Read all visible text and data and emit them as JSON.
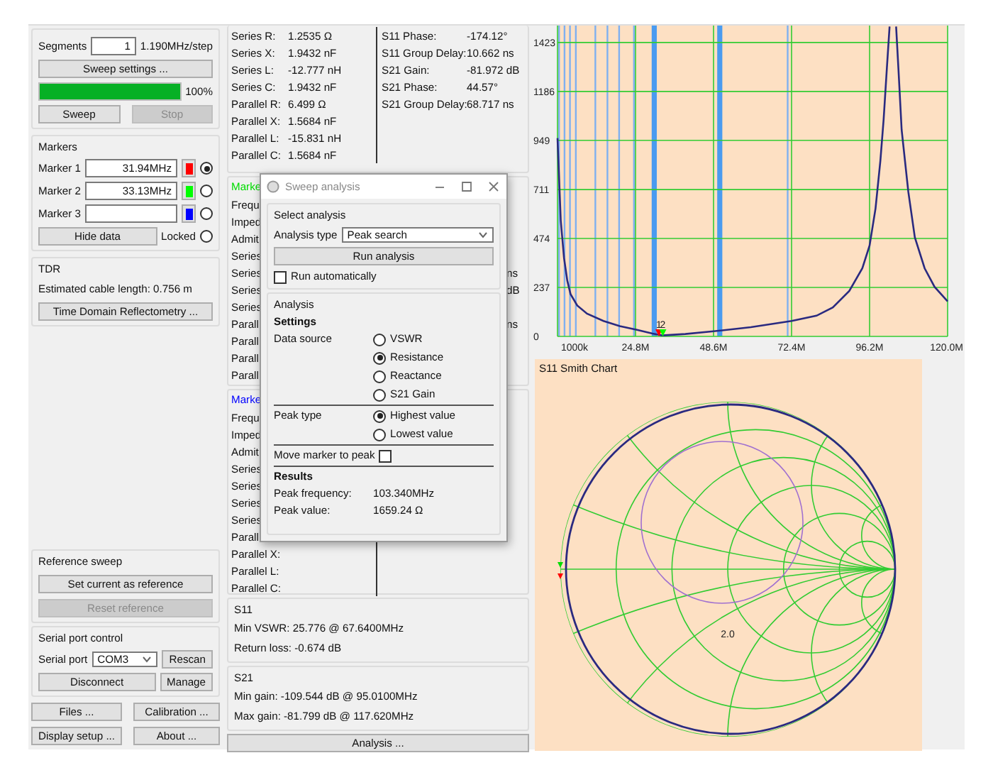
{
  "sweep_panel": {
    "segments_label": "Segments",
    "segments_value": "1",
    "step": "1.190MHz/step",
    "settings_button": "Sweep settings ...",
    "progress": {
      "level": 1,
      "reading": "100%"
    },
    "sweep_button": {
      "label": "Sweep",
      "disabled": false
    },
    "stop_button": {
      "label": "Stop",
      "disabled": true
    }
  },
  "markers_panel": {
    "title": "Markers",
    "markers": [
      {
        "label": "Marker 1",
        "value": "31.94MHz",
        "color": "#ff0000",
        "selected": true
      },
      {
        "label": "Marker 2",
        "value": "33.13MHz",
        "color": "#00ff00",
        "selected": false
      },
      {
        "label": "Marker 3",
        "color": "#0000ff",
        "selected": false
      }
    ],
    "hide_button": "Hide data",
    "locked": {
      "label": "Locked",
      "checked": false
    }
  },
  "tdr_panel": {
    "title": "TDR",
    "cable_length": "Estimated cable length:  0.756 m",
    "button": "Time Domain Reflectometry ..."
  },
  "reference_panel": {
    "title": "Reference sweep",
    "set_button": {
      "label": "Set current as reference",
      "disabled": false
    },
    "reset_button": {
      "label": "Reset reference",
      "disabled": true
    }
  },
  "serial_panel": {
    "title": "Serial port control",
    "port_label": "Serial port",
    "port_value": "COM3",
    "rescan_button": "Rescan",
    "disconnect_button": "Disconnect",
    "manage_button": "Manage"
  },
  "bottom_buttons": [
    "Files ...",
    "Calibration ...",
    "Display setup ...",
    "About ..."
  ],
  "marker_details": [
    {
      "rows": [
        {
          "label": "Series R:",
          "value": "1.2535 Ω",
          "right_label": "S11 Phase:",
          "right_value": "-174.12°"
        },
        {
          "label": "Series X:",
          "value": "1.9432 nF",
          "right_label": "S11 Group Delay:",
          "right_value": "10.662 ns"
        },
        {
          "label": "Series L:",
          "value": "-12.777 nH",
          "right_label": "S21 Gain:",
          "right_value": "-81.972 dB"
        },
        {
          "label": "Series C:",
          "value": "1.9432 nF",
          "right_label": "S21 Phase:",
          "right_value": "44.57°"
        },
        {
          "label": "Parallel R:",
          "value": "6.499 Ω",
          "right_label": "S21 Group Delay:",
          "right_value": "68.717 ns"
        },
        {
          "label": "Parallel X:",
          "value": "1.5684 nF"
        },
        {
          "label": "Parallel L:",
          "value": "-15.831 nH"
        },
        {
          "label": "Parallel C:",
          "value": "1.5684 nF"
        }
      ]
    },
    {
      "title": "Marke",
      "color": "#00dd00",
      "rows": [
        {
          "label": "Frequ"
        },
        {
          "label": "Imped"
        },
        {
          "label": "Admit"
        },
        {
          "label": "Series"
        },
        {
          "label": "Series",
          "right_value": "ns"
        },
        {
          "label": "Series",
          "right_value": "dB"
        },
        {
          "label": "Series"
        },
        {
          "label": "Parall",
          "right_value": "ns"
        },
        {
          "label": "Parall"
        },
        {
          "label": "Parall"
        },
        {
          "label": "Parall"
        }
      ]
    },
    {
      "title": "Marke",
      "color": "#0000ff",
      "rows": [
        {
          "label": "Frequ"
        },
        {
          "label": "Imped"
        },
        {
          "label": "Admit"
        },
        {
          "label": "Series"
        },
        {
          "label": "Series"
        },
        {
          "label": "Series"
        },
        {
          "label": "Series"
        },
        {
          "label": "Parall"
        },
        {
          "label": "Parallel X:"
        },
        {
          "label": "Parallel L:"
        },
        {
          "label": "Parallel C:"
        }
      ]
    }
  ],
  "s11_panel": {
    "title": "S11",
    "lines": [
      "Min VSWR:  25.776 @ 67.6400MHz",
      "Return loss:  -0.674 dB"
    ]
  },
  "s21_panel": {
    "title": "S21",
    "lines": [
      "Min gain:  -109.544 dB @ 95.0100MHz",
      "Max gain:  -81.799 dB @ 117.620MHz"
    ]
  },
  "analysis_button": "Analysis ...",
  "response_chart": {
    "chart_data": {
      "type": "line",
      "x": [
        1000000,
        2000000,
        3000000,
        4000000,
        5000000,
        7000000,
        10000000,
        15000000,
        20000000,
        25000000,
        30000000,
        33000000,
        40000000,
        48600000,
        60000000,
        72400000,
        80000000,
        85000000,
        90000000,
        94000000,
        96200000,
        98000000,
        99500000,
        100500000,
        101500000,
        102300000,
        103340000,
        104300000,
        105000000,
        106000000,
        108000000,
        110000000,
        113000000,
        116000000,
        120000000
      ],
      "series": [
        {
          "color": "#2a2a80",
          "values": [
            960,
            560,
            380,
            270,
            205,
            150,
            110,
            75,
            50,
            32,
            14,
            5,
            12,
            25,
            45,
            75,
            100,
            140,
            220,
            330,
            440,
            620,
            850,
            1050,
            1300,
            1500,
            null,
            1500,
            1300,
            1000,
            700,
            480,
            330,
            240,
            170
          ]
        }
      ],
      "xlim": [
        1000000,
        120000000
      ],
      "ylim": [
        0,
        1505
      ],
      "grid": true,
      "xticks": [
        {
          "value": 1000000,
          "label": "1000k"
        },
        {
          "value": 24800000,
          "label": "24.8M"
        },
        {
          "value": 48600000,
          "label": "48.6M"
        },
        {
          "value": 72400000,
          "label": "72.4M"
        },
        {
          "value": 96200000,
          "label": "96.2M"
        },
        {
          "value": 120000000,
          "label": "120.0M"
        }
      ],
      "yticks": [
        0,
        237,
        474,
        711,
        949,
        1186,
        1423
      ],
      "ref_lines": [
        {
          "axis": "x",
          "value": 1476000,
          "color": "#7fb0f0"
        },
        {
          "axis": "x",
          "value": 3142000,
          "color": "#7fb0f0"
        },
        {
          "axis": "x",
          "value": 4808000,
          "color": "#7fb0f0"
        },
        {
          "axis": "x",
          "value": 6593000,
          "color": "#7fb0f0"
        },
        {
          "axis": "x",
          "value": 12543000,
          "color": "#7fb0f0"
        },
        {
          "axis": "x",
          "value": 16232000,
          "color": "#7fb0f0"
        },
        {
          "axis": "x",
          "value": 19802000,
          "color": "#7fb0f0"
        },
        {
          "axis": "x",
          "value": 24324000,
          "color": "#7fb0f0"
        },
        {
          "axis": "x",
          "value": 30510000,
          "color": "#4a9bf0"
        },
        {
          "axis": "x",
          "value": 50500000,
          "color": "#4a9bf0"
        },
        {
          "axis": "x",
          "value": 71210000,
          "color": "#7fb0f0"
        }
      ],
      "annotations": [
        {
          "x": 31940000,
          "y": 0,
          "text": "1"
        },
        {
          "x": 33130000,
          "y": 0,
          "text": "2"
        }
      ]
    }
  },
  "smith_chart": {
    "title": "S11 Smith Chart",
    "circle_label": "2.0"
  },
  "dialog": {
    "title": "Sweep analysis",
    "select_group": {
      "title": "Select analysis",
      "type_label": "Analysis type",
      "type_value": "Peak search",
      "run_button": "Run analysis",
      "run_automatically": {
        "label": "Run automatically",
        "checked": false
      }
    },
    "analysis_group": {
      "title": "Analysis",
      "settings_heading": "Settings",
      "data_source_label": "Data source",
      "data_sources": [
        {
          "label": "VSWR",
          "selected": false
        },
        {
          "label": "Resistance",
          "selected": true
        },
        {
          "label": "Reactance",
          "selected": false
        },
        {
          "label": "S21 Gain",
          "selected": false
        }
      ],
      "peak_type_label": "Peak type",
      "peak_types": [
        {
          "label": "Highest value",
          "selected": true
        },
        {
          "label": "Lowest value",
          "selected": false
        }
      ],
      "move_marker": {
        "label": "Move marker to peak",
        "checked": false
      },
      "results_heading": "Results",
      "results": [
        {
          "label": "Peak frequency:",
          "value": "103.340MHz"
        },
        {
          "label": "Peak value:",
          "value": "1659.24 Ω"
        }
      ]
    }
  }
}
